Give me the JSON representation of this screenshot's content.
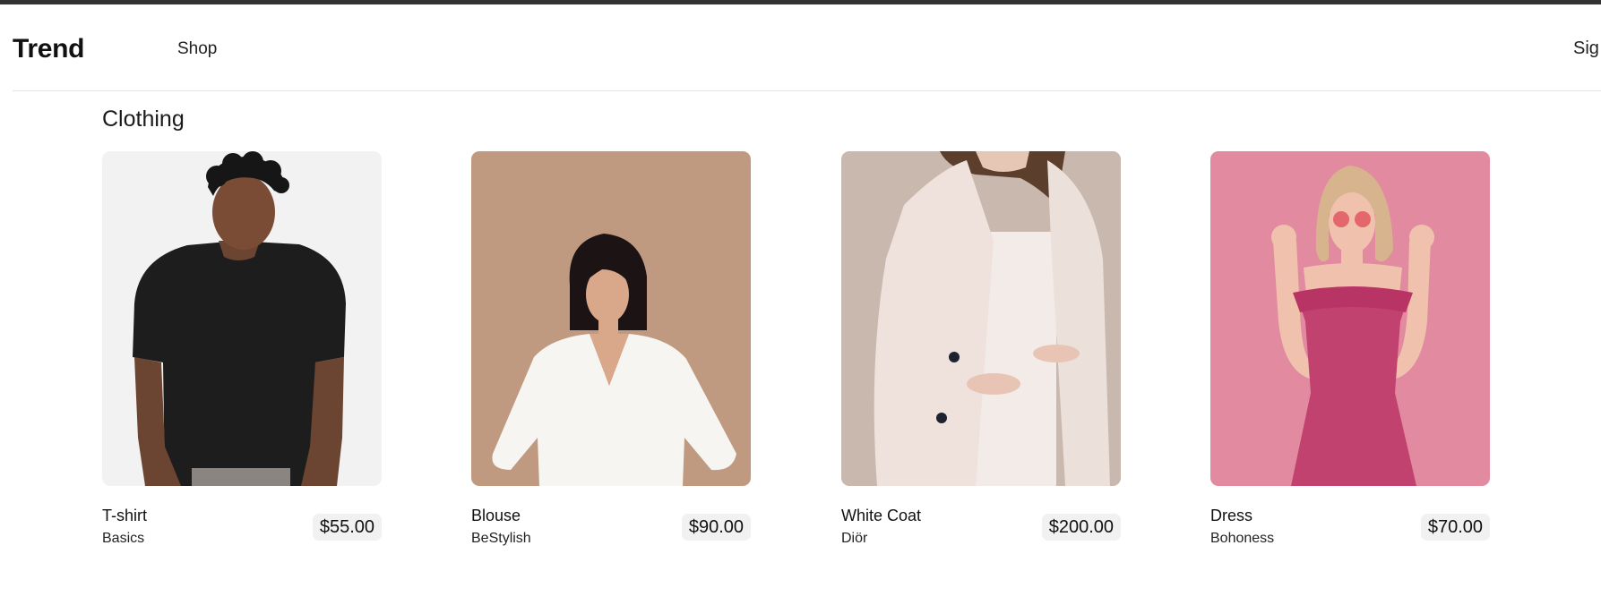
{
  "header": {
    "brand": "Trend",
    "nav_shop": "Shop",
    "nav_signin": "Sig"
  },
  "section": {
    "title": "Clothing"
  },
  "products": [
    {
      "name": "T-shirt",
      "brand": "Basics",
      "price": "$55.00",
      "photo_bg": "#f2f2f2"
    },
    {
      "name": "Blouse",
      "brand": "BeStylish",
      "price": "$90.00",
      "photo_bg": "#c09a80"
    },
    {
      "name": "White Coat",
      "brand": "Diör",
      "price": "$200.00",
      "photo_bg": "#c9b8ad"
    },
    {
      "name": "Dress",
      "brand": "Bohoness",
      "price": "$70.00",
      "photo_bg": "#e28aa0"
    }
  ],
  "colors": {
    "top_strip": "#333333",
    "divider": "#e3e3e3",
    "price_bg": "#f1f1f1"
  }
}
